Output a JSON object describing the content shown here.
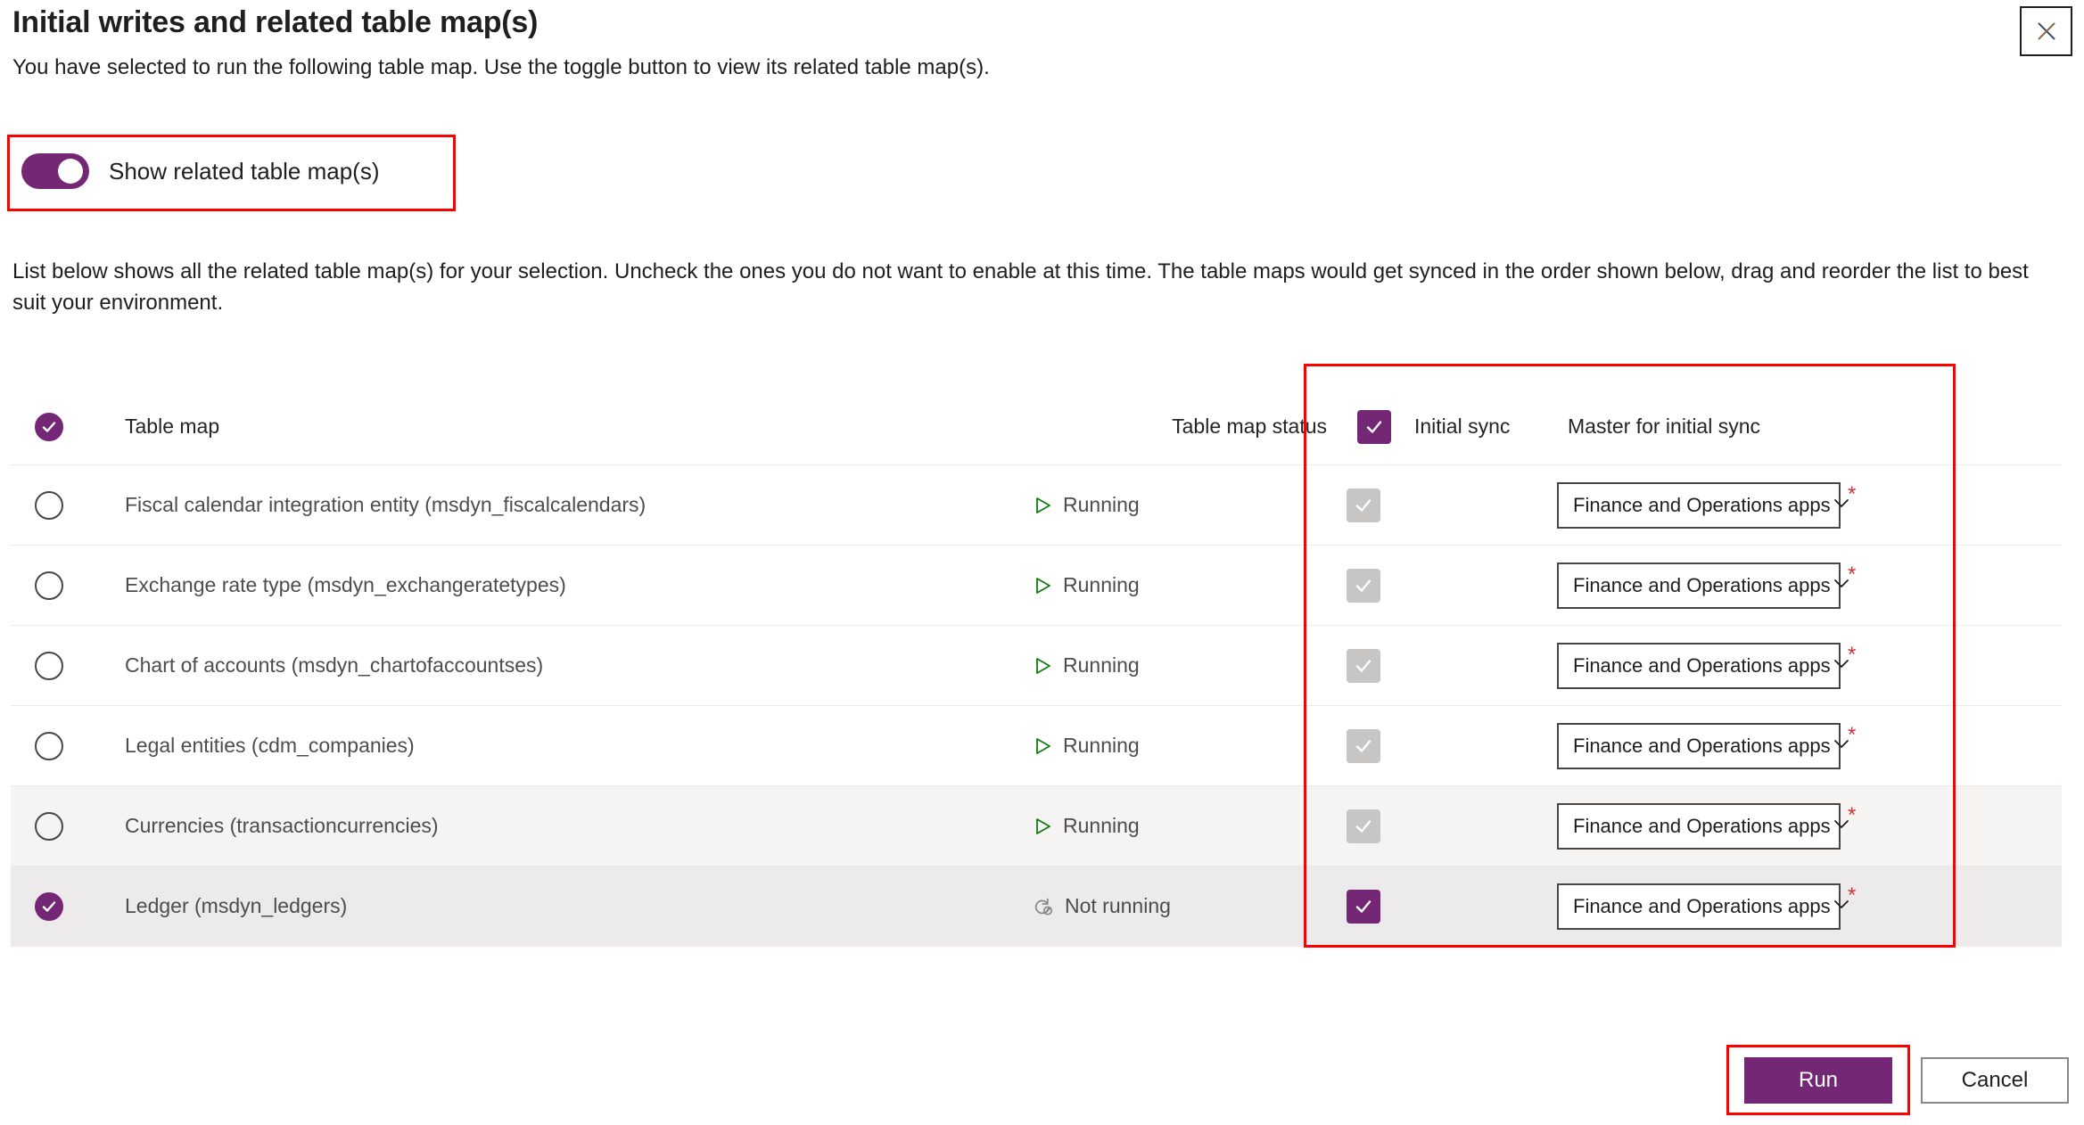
{
  "dialog": {
    "title": "Initial writes and related table map(s)",
    "subtitle": "You have selected to run the following table map. Use the toggle button to view its related table map(s).",
    "close_label": "✕"
  },
  "toggle": {
    "label": "Show related table map(s)",
    "state": "on"
  },
  "instructions": "List below shows all the related table map(s) for your selection. Uncheck the ones you do not want to enable at this time. The table maps would get synced in the order shown below, drag and reorder the list to best suit your environment.",
  "table": {
    "headers": {
      "table_map": "Table map",
      "table_map_status": "Table map status",
      "initial_sync": "Initial sync",
      "master_for_initial_sync": "Master for initial sync"
    },
    "header_select_all_checked": true,
    "header_initial_sync_checked": true,
    "rows": [
      {
        "name": "Fiscal calendar integration entity (msdyn_fiscalcalendars)",
        "status": "Running",
        "status_icon": "play-icon",
        "selected": false,
        "initial_sync_checked": true,
        "initial_sync_disabled": true,
        "master": "Finance and Operations apps",
        "required": "*"
      },
      {
        "name": "Exchange rate type (msdyn_exchangeratetypes)",
        "status": "Running",
        "status_icon": "play-icon",
        "selected": false,
        "initial_sync_checked": true,
        "initial_sync_disabled": true,
        "master": "Finance and Operations apps",
        "required": "*"
      },
      {
        "name": "Chart of accounts (msdyn_chartofaccountses)",
        "status": "Running",
        "status_icon": "play-icon",
        "selected": false,
        "initial_sync_checked": true,
        "initial_sync_disabled": true,
        "master": "Finance and Operations apps",
        "required": "*"
      },
      {
        "name": "Legal entities (cdm_companies)",
        "status": "Running",
        "status_icon": "play-icon",
        "selected": false,
        "initial_sync_checked": true,
        "initial_sync_disabled": true,
        "master": "Finance and Operations apps",
        "required": "*"
      },
      {
        "name": "Currencies (transactioncurrencies)",
        "status": "Running",
        "status_icon": "play-icon",
        "selected": false,
        "initial_sync_checked": true,
        "initial_sync_disabled": true,
        "master": "Finance and Operations apps",
        "required": "*"
      },
      {
        "name": "Ledger (msdyn_ledgers)",
        "status": "Not running",
        "status_icon": "not-running-icon",
        "selected": true,
        "initial_sync_checked": true,
        "initial_sync_disabled": false,
        "master": "Finance and Operations apps",
        "required": "*"
      }
    ]
  },
  "footer": {
    "run_label": "Run",
    "cancel_label": "Cancel"
  },
  "colors": {
    "accent_purple": "#742774",
    "highlight_red": "#ff0000",
    "status_running_green": "#107c10",
    "required_red": "#d13438"
  }
}
